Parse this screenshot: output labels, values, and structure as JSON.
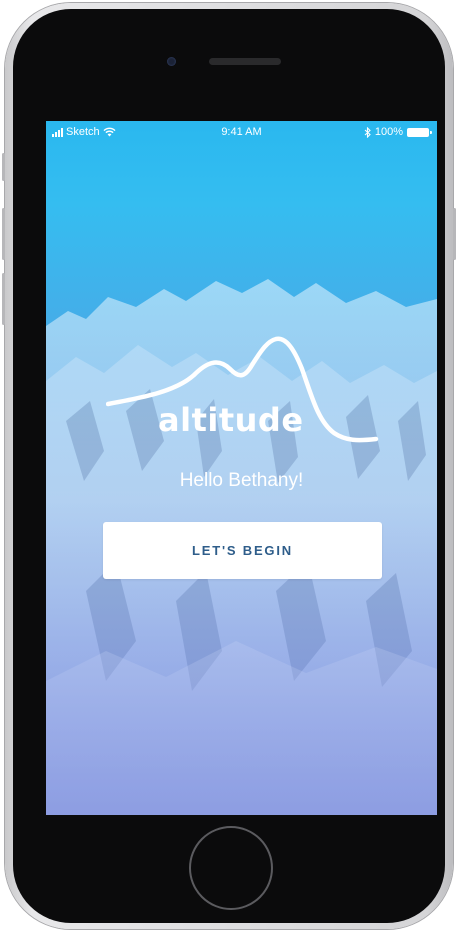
{
  "status_bar": {
    "carrier": "Sketch",
    "time": "9:41 AM",
    "battery": "100%",
    "signal_icon": "signal-bars-icon",
    "wifi_icon": "wifi-icon",
    "bluetooth_icon": "bluetooth-icon",
    "battery_icon": "battery-icon"
  },
  "app": {
    "logo_text": "altitude",
    "greeting": "Hello Bethany!",
    "cta_label": "LET'S BEGIN"
  },
  "colors": {
    "cta_text": "#2e5d8a",
    "screen_top": "#2ab8ef",
    "screen_bottom": "#6b7fd8"
  }
}
